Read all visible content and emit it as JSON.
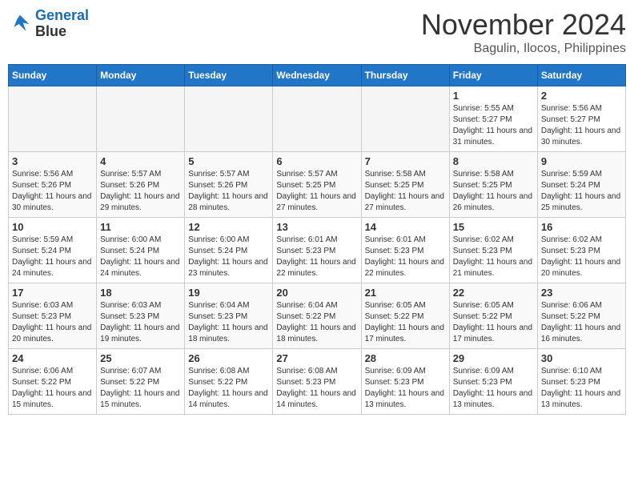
{
  "logo": {
    "line1": "General",
    "line2": "Blue"
  },
  "title": "November 2024",
  "location": "Bagulin, Ilocos, Philippines",
  "weekdays": [
    "Sunday",
    "Monday",
    "Tuesday",
    "Wednesday",
    "Thursday",
    "Friday",
    "Saturday"
  ],
  "weeks": [
    [
      {
        "day": "",
        "empty": true
      },
      {
        "day": "",
        "empty": true
      },
      {
        "day": "",
        "empty": true
      },
      {
        "day": "",
        "empty": true
      },
      {
        "day": "",
        "empty": true
      },
      {
        "day": "1",
        "sunrise": "Sunrise: 5:55 AM",
        "sunset": "Sunset: 5:27 PM",
        "daylight": "Daylight: 11 hours and 31 minutes."
      },
      {
        "day": "2",
        "sunrise": "Sunrise: 5:56 AM",
        "sunset": "Sunset: 5:27 PM",
        "daylight": "Daylight: 11 hours and 30 minutes."
      }
    ],
    [
      {
        "day": "3",
        "sunrise": "Sunrise: 5:56 AM",
        "sunset": "Sunset: 5:26 PM",
        "daylight": "Daylight: 11 hours and 30 minutes."
      },
      {
        "day": "4",
        "sunrise": "Sunrise: 5:57 AM",
        "sunset": "Sunset: 5:26 PM",
        "daylight": "Daylight: 11 hours and 29 minutes."
      },
      {
        "day": "5",
        "sunrise": "Sunrise: 5:57 AM",
        "sunset": "Sunset: 5:26 PM",
        "daylight": "Daylight: 11 hours and 28 minutes."
      },
      {
        "day": "6",
        "sunrise": "Sunrise: 5:57 AM",
        "sunset": "Sunset: 5:25 PM",
        "daylight": "Daylight: 11 hours and 27 minutes."
      },
      {
        "day": "7",
        "sunrise": "Sunrise: 5:58 AM",
        "sunset": "Sunset: 5:25 PM",
        "daylight": "Daylight: 11 hours and 27 minutes."
      },
      {
        "day": "8",
        "sunrise": "Sunrise: 5:58 AM",
        "sunset": "Sunset: 5:25 PM",
        "daylight": "Daylight: 11 hours and 26 minutes."
      },
      {
        "day": "9",
        "sunrise": "Sunrise: 5:59 AM",
        "sunset": "Sunset: 5:24 PM",
        "daylight": "Daylight: 11 hours and 25 minutes."
      }
    ],
    [
      {
        "day": "10",
        "sunrise": "Sunrise: 5:59 AM",
        "sunset": "Sunset: 5:24 PM",
        "daylight": "Daylight: 11 hours and 24 minutes."
      },
      {
        "day": "11",
        "sunrise": "Sunrise: 6:00 AM",
        "sunset": "Sunset: 5:24 PM",
        "daylight": "Daylight: 11 hours and 24 minutes."
      },
      {
        "day": "12",
        "sunrise": "Sunrise: 6:00 AM",
        "sunset": "Sunset: 5:24 PM",
        "daylight": "Daylight: 11 hours and 23 minutes."
      },
      {
        "day": "13",
        "sunrise": "Sunrise: 6:01 AM",
        "sunset": "Sunset: 5:23 PM",
        "daylight": "Daylight: 11 hours and 22 minutes."
      },
      {
        "day": "14",
        "sunrise": "Sunrise: 6:01 AM",
        "sunset": "Sunset: 5:23 PM",
        "daylight": "Daylight: 11 hours and 22 minutes."
      },
      {
        "day": "15",
        "sunrise": "Sunrise: 6:02 AM",
        "sunset": "Sunset: 5:23 PM",
        "daylight": "Daylight: 11 hours and 21 minutes."
      },
      {
        "day": "16",
        "sunrise": "Sunrise: 6:02 AM",
        "sunset": "Sunset: 5:23 PM",
        "daylight": "Daylight: 11 hours and 20 minutes."
      }
    ],
    [
      {
        "day": "17",
        "sunrise": "Sunrise: 6:03 AM",
        "sunset": "Sunset: 5:23 PM",
        "daylight": "Daylight: 11 hours and 20 minutes."
      },
      {
        "day": "18",
        "sunrise": "Sunrise: 6:03 AM",
        "sunset": "Sunset: 5:23 PM",
        "daylight": "Daylight: 11 hours and 19 minutes."
      },
      {
        "day": "19",
        "sunrise": "Sunrise: 6:04 AM",
        "sunset": "Sunset: 5:23 PM",
        "daylight": "Daylight: 11 hours and 18 minutes."
      },
      {
        "day": "20",
        "sunrise": "Sunrise: 6:04 AM",
        "sunset": "Sunset: 5:22 PM",
        "daylight": "Daylight: 11 hours and 18 minutes."
      },
      {
        "day": "21",
        "sunrise": "Sunrise: 6:05 AM",
        "sunset": "Sunset: 5:22 PM",
        "daylight": "Daylight: 11 hours and 17 minutes."
      },
      {
        "day": "22",
        "sunrise": "Sunrise: 6:05 AM",
        "sunset": "Sunset: 5:22 PM",
        "daylight": "Daylight: 11 hours and 17 minutes."
      },
      {
        "day": "23",
        "sunrise": "Sunrise: 6:06 AM",
        "sunset": "Sunset: 5:22 PM",
        "daylight": "Daylight: 11 hours and 16 minutes."
      }
    ],
    [
      {
        "day": "24",
        "sunrise": "Sunrise: 6:06 AM",
        "sunset": "Sunset: 5:22 PM",
        "daylight": "Daylight: 11 hours and 15 minutes."
      },
      {
        "day": "25",
        "sunrise": "Sunrise: 6:07 AM",
        "sunset": "Sunset: 5:22 PM",
        "daylight": "Daylight: 11 hours and 15 minutes."
      },
      {
        "day": "26",
        "sunrise": "Sunrise: 6:08 AM",
        "sunset": "Sunset: 5:22 PM",
        "daylight": "Daylight: 11 hours and 14 minutes."
      },
      {
        "day": "27",
        "sunrise": "Sunrise: 6:08 AM",
        "sunset": "Sunset: 5:23 PM",
        "daylight": "Daylight: 11 hours and 14 minutes."
      },
      {
        "day": "28",
        "sunrise": "Sunrise: 6:09 AM",
        "sunset": "Sunset: 5:23 PM",
        "daylight": "Daylight: 11 hours and 13 minutes."
      },
      {
        "day": "29",
        "sunrise": "Sunrise: 6:09 AM",
        "sunset": "Sunset: 5:23 PM",
        "daylight": "Daylight: 11 hours and 13 minutes."
      },
      {
        "day": "30",
        "sunrise": "Sunrise: 6:10 AM",
        "sunset": "Sunset: 5:23 PM",
        "daylight": "Daylight: 11 hours and 13 minutes."
      }
    ]
  ]
}
